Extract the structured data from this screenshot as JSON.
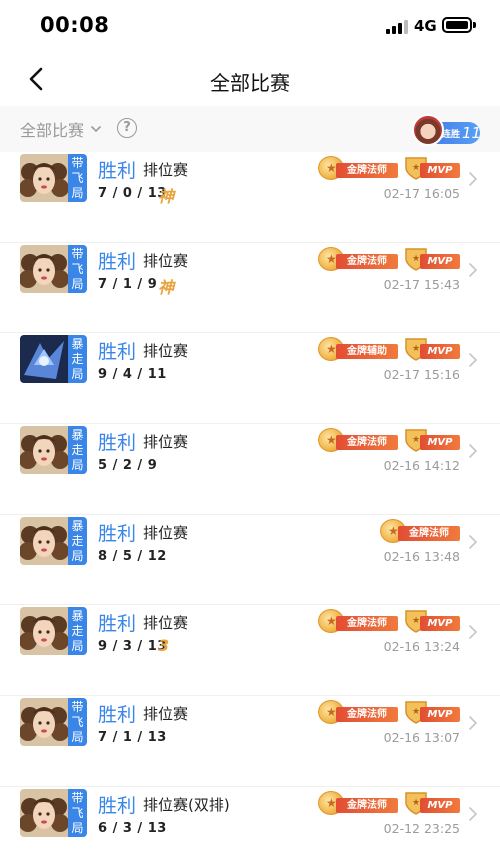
{
  "status_bar": {
    "time": "00:08",
    "network": "4G"
  },
  "nav": {
    "title": "全部比赛"
  },
  "filter": {
    "label": "全部比赛",
    "help_glyph": "?",
    "streak_label": "连胜",
    "streak_count": "11"
  },
  "matches": [
    {
      "hero": "mage",
      "mode_tag": [
        "带",
        "飞",
        "局"
      ],
      "result": "胜利",
      "type": "排位赛",
      "kda": "7 / 0 / 13",
      "extra": "神",
      "badges": {
        "gold": "金牌法师",
        "mvp": "MVP"
      },
      "time": "02-17 16:05"
    },
    {
      "hero": "mage",
      "mode_tag": [
        "带",
        "飞",
        "局"
      ],
      "result": "胜利",
      "type": "排位赛",
      "kda": "7 / 1 / 9",
      "extra": "神",
      "badges": {
        "gold": "金牌法师",
        "mvp": "MVP"
      },
      "time": "02-17 15:43"
    },
    {
      "hero": "support",
      "mode_tag": [
        "暴",
        "走",
        "局"
      ],
      "result": "胜利",
      "type": "排位赛",
      "kda": "9 / 4 / 11",
      "extra": "",
      "badges": {
        "gold": "金牌辅助",
        "mvp": "MVP"
      },
      "time": "02-17 15:16"
    },
    {
      "hero": "mage",
      "mode_tag": [
        "暴",
        "走",
        "局"
      ],
      "result": "胜利",
      "type": "排位赛",
      "kda": "5 / 2 / 9",
      "extra": "",
      "badges": {
        "gold": "金牌法师",
        "mvp": "MVP"
      },
      "time": "02-16 14:12"
    },
    {
      "hero": "mage",
      "mode_tag": [
        "暴",
        "走",
        "局"
      ],
      "result": "胜利",
      "type": "排位赛",
      "kda": "8 / 5 / 12",
      "extra": "",
      "badges": {
        "gold": "金牌法师",
        "mvp": ""
      },
      "time": "02-16 13:48"
    },
    {
      "hero": "mage",
      "mode_tag": [
        "暴",
        "走",
        "局"
      ],
      "result": "胜利",
      "type": "排位赛",
      "kda": "9 / 3 / 13",
      "extra": "3",
      "badges": {
        "gold": "金牌法师",
        "mvp": "MVP"
      },
      "time": "02-16 13:24"
    },
    {
      "hero": "mage",
      "mode_tag": [
        "带",
        "飞",
        "局"
      ],
      "result": "胜利",
      "type": "排位赛",
      "kda": "7 / 1 / 13",
      "extra": "",
      "badges": {
        "gold": "金牌法师",
        "mvp": "MVP"
      },
      "time": "02-16 13:07"
    },
    {
      "hero": "mage",
      "mode_tag": [
        "带",
        "飞",
        "局"
      ],
      "result": "胜利",
      "type": "排位赛(双排)",
      "kda": "6 / 3 / 13",
      "extra": "",
      "badges": {
        "gold": "金牌法师",
        "mvp": "MVP"
      },
      "time": "02-12 23:25"
    }
  ]
}
